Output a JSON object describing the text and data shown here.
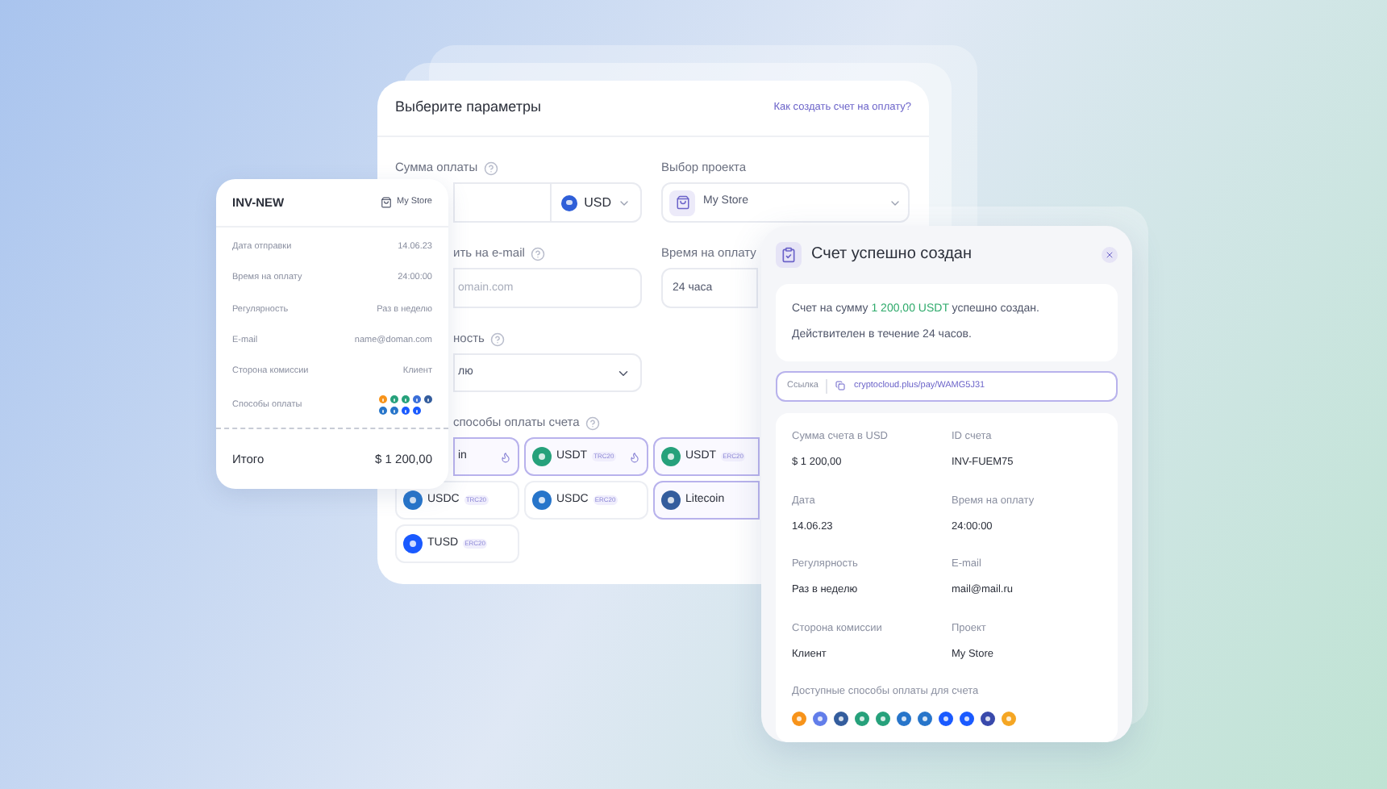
{
  "form": {
    "title": "Выберите параметры",
    "help_link": "Как создать счет на оплату?",
    "amount": {
      "label": "Сумма оплаты",
      "currency": "USD"
    },
    "project": {
      "label": "Выбор проекта",
      "value": "My Store"
    },
    "email": {
      "label": "ить на e-mail",
      "placeholder": "omain.com"
    },
    "time": {
      "label": "Время на оплату",
      "value": "24 часа"
    },
    "regularity": {
      "label": "ность",
      "value": "лю"
    },
    "methods_label": "способы оплаты счета",
    "methods": [
      {
        "label": "in",
        "selected": true,
        "hot": true
      },
      {
        "label": "USDT",
        "network": "TRC20",
        "selected": true,
        "hot": true,
        "color": "#26a17b"
      },
      {
        "label": "USDT",
        "network": "ERC20",
        "selected": true,
        "hot": false,
        "color": "#26a17b"
      },
      {
        "label": "USDC",
        "network": "TRC20",
        "selected": false,
        "hot": false,
        "color": "#2775ca"
      },
      {
        "label": "USDC",
        "network": "ERC20",
        "selected": false,
        "hot": false,
        "color": "#2775ca"
      },
      {
        "label": "Litecoin",
        "selected": true,
        "hot": false,
        "color": "#345d9d"
      },
      {
        "label": "TUSD",
        "network": "ERC20",
        "selected": false,
        "hot": false,
        "color": "#1a5aff"
      }
    ]
  },
  "summary": {
    "title": "INV-NEW",
    "project": "My Store",
    "rows": [
      {
        "label": "Дата отправки",
        "value": "14.06.23"
      },
      {
        "label": "Время на оплату",
        "value": "24:00:00"
      },
      {
        "label": "Регулярность",
        "value": "Раз в неделю"
      },
      {
        "label": "E-mail",
        "value": "name@doman.com"
      },
      {
        "label": "Сторона комиссии",
        "value": "Клиент"
      }
    ],
    "methods_label": "Способы оплаты",
    "method_icons": [
      {
        "color": "#f7931a"
      },
      {
        "color": "#26a17b"
      },
      {
        "color": "#26a17b"
      },
      {
        "color": "#3b6fd8"
      },
      {
        "color": "#345d9d"
      },
      {
        "color": "#2775ca"
      },
      {
        "color": "#2775ca"
      },
      {
        "color": "#1a5aff"
      },
      {
        "color": "#1a5aff"
      }
    ],
    "total_label": "Итого",
    "total": "$ 1 200,00"
  },
  "success": {
    "title": "Счет успешно создан",
    "message": {
      "before": "Счет на сумму ",
      "amount": "1 200,00 USDT",
      "after": " успешно создан. Действителен в течение 24 часов."
    },
    "link": {
      "label": "Ссылка",
      "url": "cryptocloud.plus/pay/WAMG5J31"
    },
    "details": [
      {
        "label": "Сумма счета в USD",
        "value": "$ 1 200,00"
      },
      {
        "label": "ID счета",
        "value": "INV-FUEM75"
      },
      {
        "label": "Дата",
        "value": "14.06.23"
      },
      {
        "label": "Время на оплату",
        "value": "24:00:00"
      },
      {
        "label": "Регулярность",
        "value": "Раз в неделю"
      },
      {
        "label": "E-mail",
        "value": "mail@mail.ru"
      },
      {
        "label": "Сторона комиссии",
        "value": "Клиент"
      },
      {
        "label": "Проект",
        "value": "My Store"
      }
    ],
    "methods_label": "Доступные способы оплаты для счета",
    "method_icons": [
      {
        "color": "#f7931a"
      },
      {
        "color": "#627eea"
      },
      {
        "color": "#345d9d"
      },
      {
        "color": "#26a17b"
      },
      {
        "color": "#26a17b"
      },
      {
        "color": "#2775ca"
      },
      {
        "color": "#2775ca"
      },
      {
        "color": "#1a5aff"
      },
      {
        "color": "#1a5aff"
      },
      {
        "color": "#3949ab"
      },
      {
        "color": "#f5a623"
      }
    ]
  }
}
